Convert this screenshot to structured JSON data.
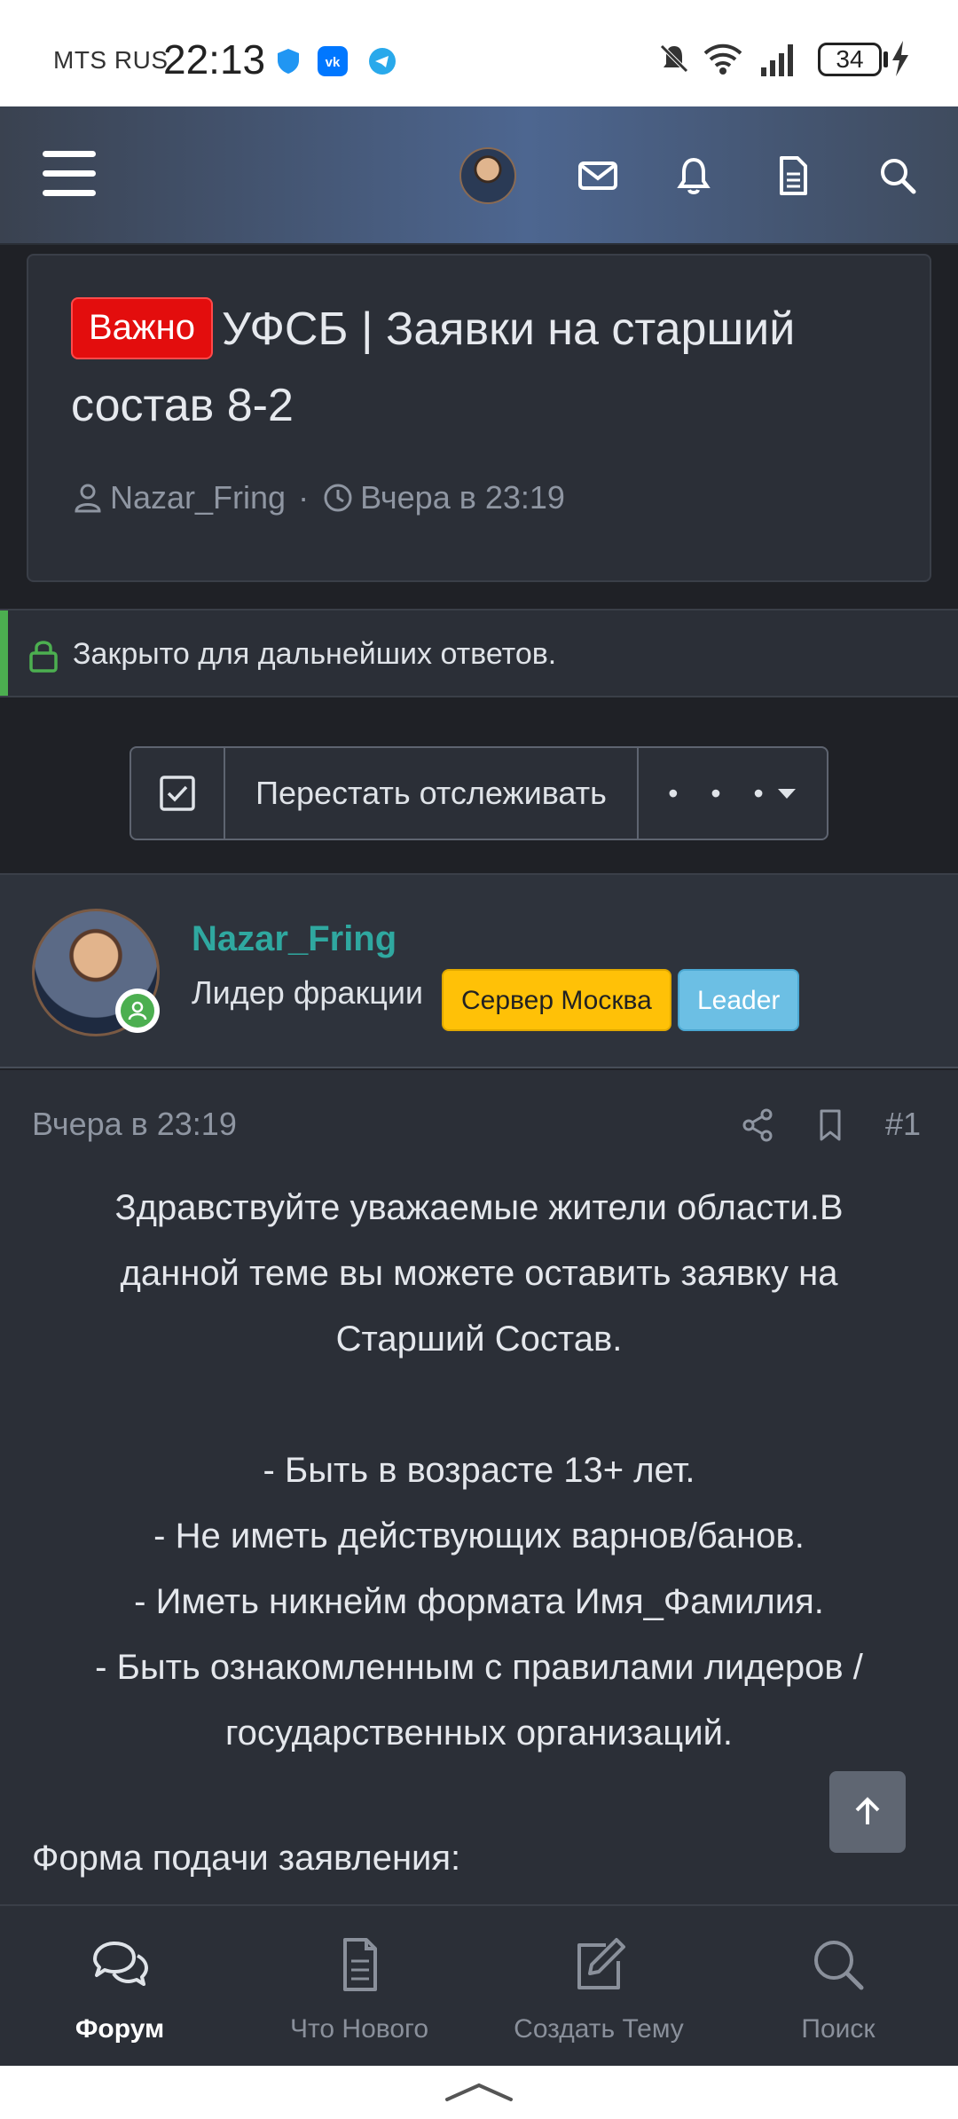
{
  "status_bar": {
    "carrier": "MTS RUS",
    "time": "22:13",
    "battery": "34"
  },
  "header": {
    "icons": [
      "menu-icon",
      "avatar",
      "mail-icon",
      "bell-icon",
      "document-icon",
      "search-icon"
    ]
  },
  "thread": {
    "prefix": "Важно",
    "title": "УФСБ | Заявки на старший состав 8-2",
    "author": "Nazar_Fring",
    "separator": "·",
    "date": "Вчера в 23:19"
  },
  "closed_notice": "Закрыто для дальнейших ответов.",
  "watch": {
    "label": "Перестать отслеживать",
    "more": "• • •"
  },
  "author_block": {
    "name": "Nazar_Fring",
    "role": "Лидер фракции",
    "tags": [
      "Сервер Москва",
      "Leader"
    ]
  },
  "post": {
    "date": "Вчера в 23:19",
    "number": "#1",
    "intro_lines": [
      "Здравствуйте уважаемые жители области.В",
      "данной теме вы можете оставить заявку на",
      "Старший Состав."
    ],
    "requirements": [
      "- Быть в возрасте 13+ лет.",
      "- Не иметь действующих варнов/банов.",
      "- Иметь никнейм формата Имя_Фамилия.",
      "- Быть ознакомленным с правилами лидеров /",
      "государственных организаций."
    ],
    "form_heading": "Форма подачи заявления:"
  },
  "bottom_nav": [
    {
      "label": "Форум",
      "icon": "forum-icon",
      "active": true
    },
    {
      "label": "Что Нового",
      "icon": "whats-new-icon",
      "active": false
    },
    {
      "label": "Создать Тему",
      "icon": "create-topic-icon",
      "active": false
    },
    {
      "label": "Поиск",
      "icon": "search-icon",
      "active": false
    }
  ],
  "colors": {
    "accent_important": "#e30d0d",
    "author_name": "#2fa8a0",
    "tag_server": "#ffc107",
    "tag_leader": "#6cbfe4",
    "online": "#4caf50"
  }
}
